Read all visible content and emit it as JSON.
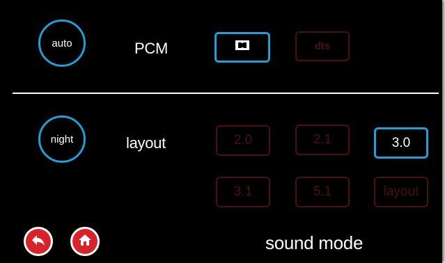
{
  "top_row": {
    "auto_label": "auto",
    "input_label": "PCM",
    "dolby_icon": "dolby-icon",
    "dts_label": "dts"
  },
  "bottom_row": {
    "night_label": "night",
    "layout_label": "layout",
    "channels": [
      "2.0",
      "2.1",
      "3.0",
      "3.1",
      "5.1",
      "layout"
    ],
    "selected_channel": "3.0"
  },
  "footer": {
    "back_icon": "back-arrow-icon",
    "home_icon": "home-icon",
    "title": "sound mode"
  },
  "colors": {
    "accent": "#1e9fd6",
    "inactive": "#4a1012",
    "nav_red": "#d9232a",
    "background": "#000000"
  }
}
